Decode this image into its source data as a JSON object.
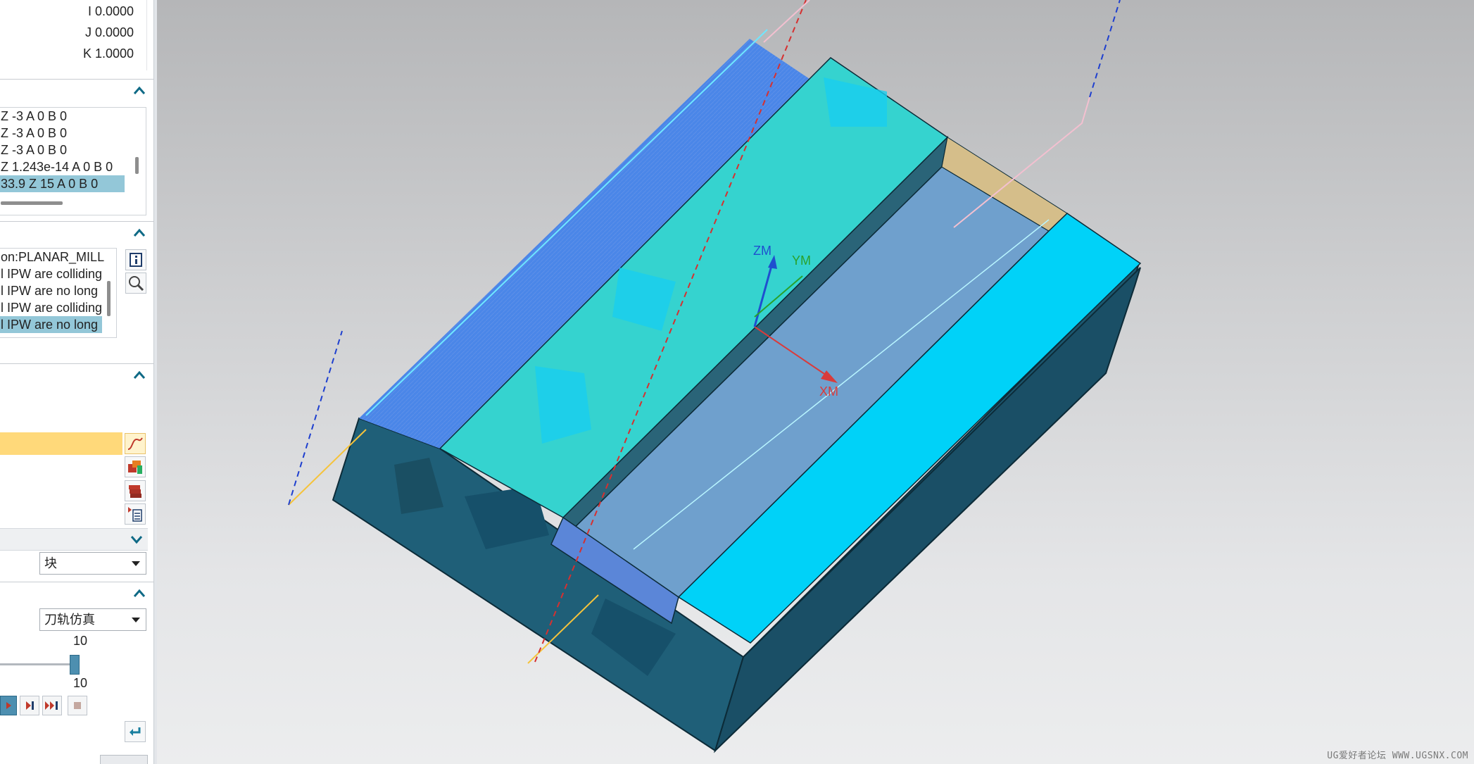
{
  "vector": {
    "i": "I 0.0000",
    "j": "J 0.0000",
    "k": "K 1.0000"
  },
  "points_list": {
    "items": [
      "Z -3 A 0 B 0",
      "Z -3 A 0 B 0",
      "Z -3 A 0 B 0",
      "Z 1.243e-14 A 0 B 0",
      "33.9 Z 15 A 0 B 0"
    ],
    "selected_index": 4
  },
  "messages_list": {
    "items": [
      "on:PLANAR_MILL",
      "l IPW are colliding",
      "l IPW are no long",
      "l IPW are colliding",
      "l IPW are no long"
    ],
    "selected_index": 4
  },
  "display_options": {
    "ipw_dropdown": "块"
  },
  "animation": {
    "mode_dropdown": "刀轨仿真",
    "speed_top_value": "10",
    "speed_bottom_value": "10",
    "speed_level": 1.0
  },
  "viewport": {
    "axis_labels": {
      "zm": "ZM",
      "ym": "YM",
      "xm": "XM"
    },
    "watermark": "UG爱好者论坛 WWW.UGSNX.COM"
  },
  "colors": {
    "accent_yellow": "#ffd97a",
    "selection_blue": "#93c7d8",
    "face_cyan": "#00d2f8",
    "face_teal": "#35d3cf",
    "side_dark": "#1d5b74"
  }
}
